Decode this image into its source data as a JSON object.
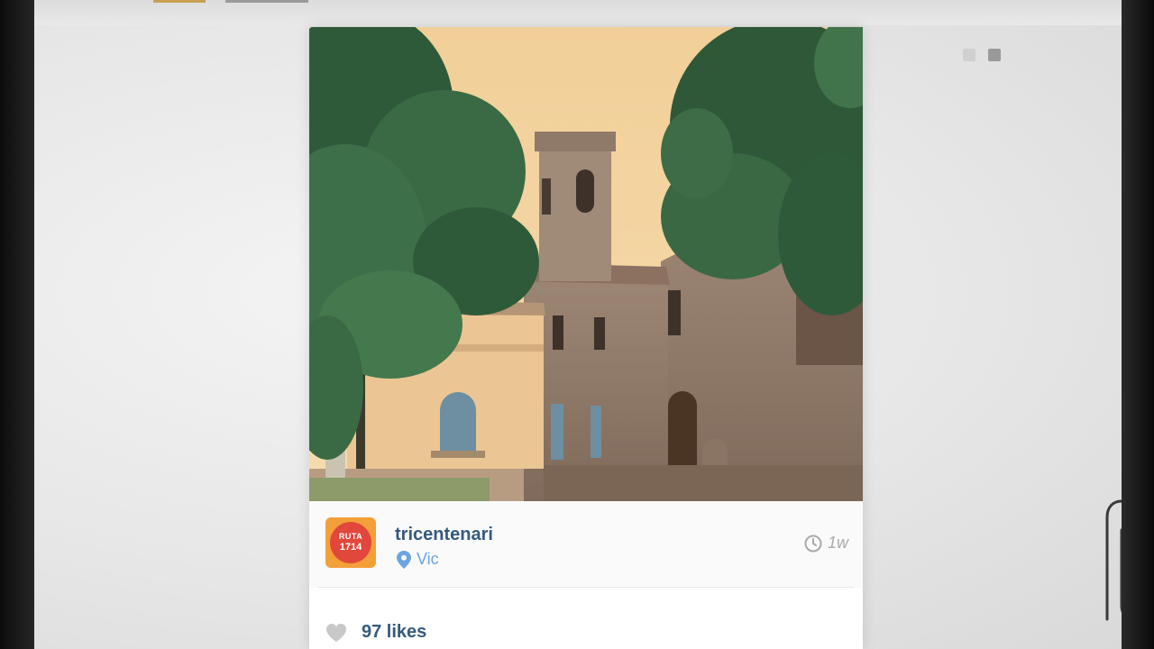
{
  "post": {
    "username": "tricentenari",
    "location": "Vic",
    "time_ago": "1w",
    "likes": "97 likes",
    "avatar": {
      "line1": "RUTA",
      "line2": "1714",
      "outer_color": "#f3a03a",
      "inner_color": "#e2473b"
    },
    "photo_subject": "stone church with bell tower among trees"
  },
  "icons": {
    "location": "map-pin-icon",
    "time": "clock-icon",
    "like": "heart-icon",
    "decor": "paperclip"
  },
  "colors": {
    "username": "#355a7e",
    "location": "#6aa5e0",
    "timestamp": "#a9a9a9"
  }
}
